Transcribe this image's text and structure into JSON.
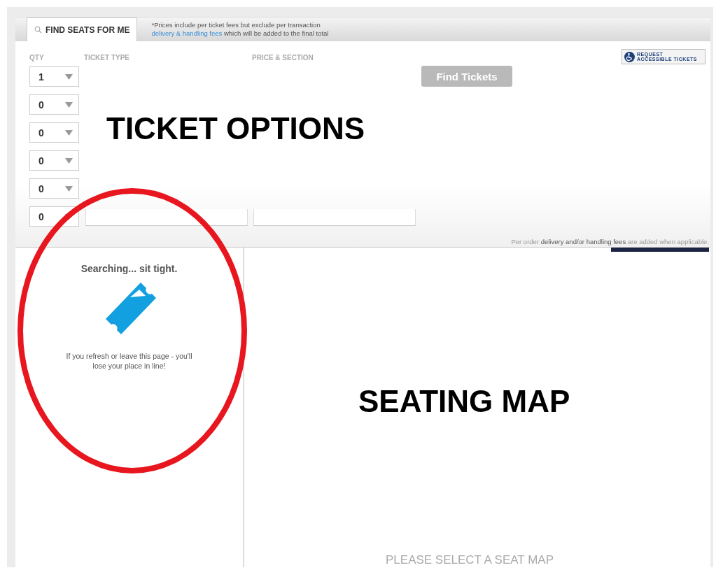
{
  "tabs": [
    {
      "label": "FIND SEATS FOR ME",
      "selected": true
    }
  ],
  "fee_note": {
    "text": "*Prices include per ticket fees but exclude per transaction",
    "link": "delivery & handling fees",
    "rest": "which will be added to the final total"
  },
  "ticket_options": {
    "columns": [
      "QTY",
      "TICKET TYPE",
      "PRICE & SECTION"
    ],
    "qty_selects": [
      {
        "value": "1"
      },
      {
        "value": "0"
      },
      {
        "value": "0"
      },
      {
        "value": "0"
      },
      {
        "value": "0"
      },
      {
        "value": "0"
      }
    ],
    "find_button": {
      "label": "Find Tickets",
      "disabled": true
    },
    "accessible_button": {
      "line_1": "REQUEST",
      "line_2": "ACCESSIBLE TICKETS"
    },
    "annotation": "TICKET OPTIONS",
    "footer_note": "Per order **delivery and/or handling fees** are added when applicable."
  },
  "queue": {
    "title": "Searching... sit tight.",
    "message": "If you refresh or leave this page - you'll lose your place in line!"
  },
  "seat_map": {
    "annotation": "SEATING MAP",
    "placeholder": "PLEASE SELECT A SEAT MAP"
  }
}
